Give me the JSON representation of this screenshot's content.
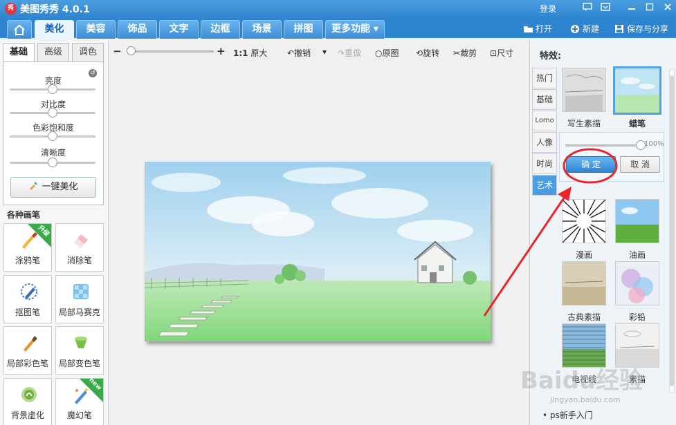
{
  "app": {
    "title": "美图秀秀 4.0.1",
    "logo_text": "秀",
    "login": "登录"
  },
  "nav": {
    "tabs": [
      "美化",
      "美容",
      "饰品",
      "文字",
      "边框",
      "场景",
      "拼图",
      "更多功能"
    ],
    "active": "美化",
    "open": "打开",
    "new": "新建",
    "save": "保存与分享"
  },
  "left": {
    "tabs": [
      "基础",
      "高级",
      "调色"
    ],
    "sliders": [
      {
        "label": "亮度",
        "value": 0.5
      },
      {
        "label": "对比度",
        "value": 0.5
      },
      {
        "label": "色彩饱和度",
        "value": 0.5
      },
      {
        "label": "清晰度",
        "value": 0.5
      }
    ],
    "one_key": "一键美化",
    "brushes_title": "各种画笔",
    "tools": [
      {
        "label": "涂鸦笔",
        "badge": "升级"
      },
      {
        "label": "消除笔",
        "badge": ""
      },
      {
        "label": "抠图笔",
        "badge": ""
      },
      {
        "label": "局部马赛克",
        "badge": ""
      },
      {
        "label": "局部彩色笔",
        "badge": ""
      },
      {
        "label": "局部变色笔",
        "badge": ""
      },
      {
        "label": "背景虚化",
        "badge": ""
      },
      {
        "label": "魔幻笔",
        "badge": "new"
      }
    ]
  },
  "toolbar": {
    "zoom_minus": "−",
    "zoom_plus": "+",
    "zoom_value": 0.0,
    "actual_size_prefix": "1:1",
    "actual_size": "原大",
    "undo": "撤销",
    "redo": "重做",
    "original": "原图",
    "rotate": "旋转",
    "crop": "裁剪",
    "resize": "尺寸"
  },
  "right": {
    "title": "特效:",
    "tabs": [
      "热门",
      "基础",
      "Lomo",
      "人像",
      "时尚",
      "艺术"
    ],
    "active_tab": "艺术",
    "effects_top": [
      {
        "label": "写生素描",
        "selected": false
      },
      {
        "label": "蜡笔",
        "selected": true
      }
    ],
    "strength": "100%",
    "strength_value": 1.0,
    "ok": "确 定",
    "cancel": "取 消",
    "effects": [
      "漫画",
      "油画",
      "古典素描",
      "彩铅",
      "电视线",
      "素描"
    ],
    "bottom_link": "ps新手入门"
  },
  "watermark": {
    "main": "Baidu经验",
    "sub": "jingyan.baidu.com"
  },
  "colors": {
    "title_bar": "#2f84cf",
    "accent": "#4a9ee0",
    "annotation": "#e8252a",
    "badge_green": "#39a94a"
  }
}
